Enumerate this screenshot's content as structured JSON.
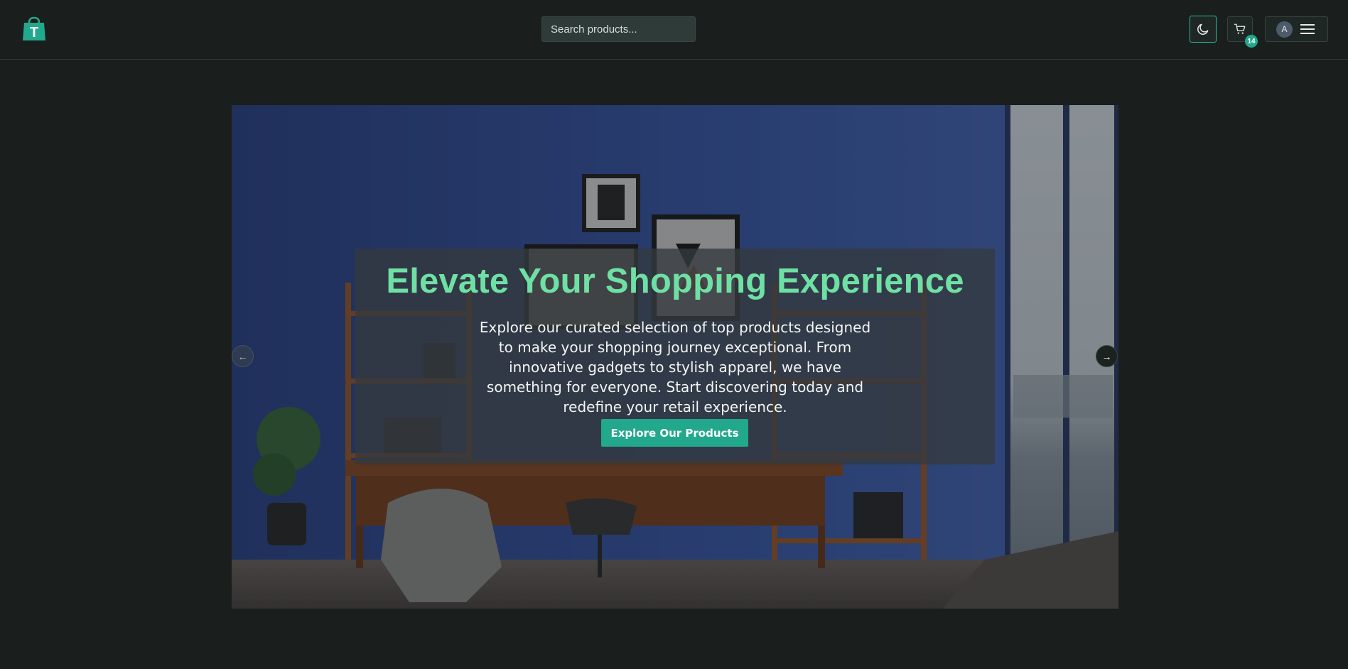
{
  "header": {
    "logo_letter": "T",
    "search_placeholder": "Search products...",
    "theme_icon": "moon-icon",
    "cart_icon": "cart-icon",
    "cart_count": "14",
    "user_initial": "A",
    "menu_icon": "hamburger-icon"
  },
  "hero": {
    "title": "Elevate Your Shopping Experience",
    "description": "Explore our curated selection of top products designed to make your shopping journey exceptional. From innovative gadgets to stylish apparel, we have something for everyone. Start discovering today and redefine your retail experience.",
    "cta_label": "Explore Our Products",
    "prev_arrow": "←",
    "next_arrow": "→"
  },
  "colors": {
    "accent": "#22a88c",
    "title_green": "#6fe0a4",
    "background": "#1a1f1e"
  }
}
